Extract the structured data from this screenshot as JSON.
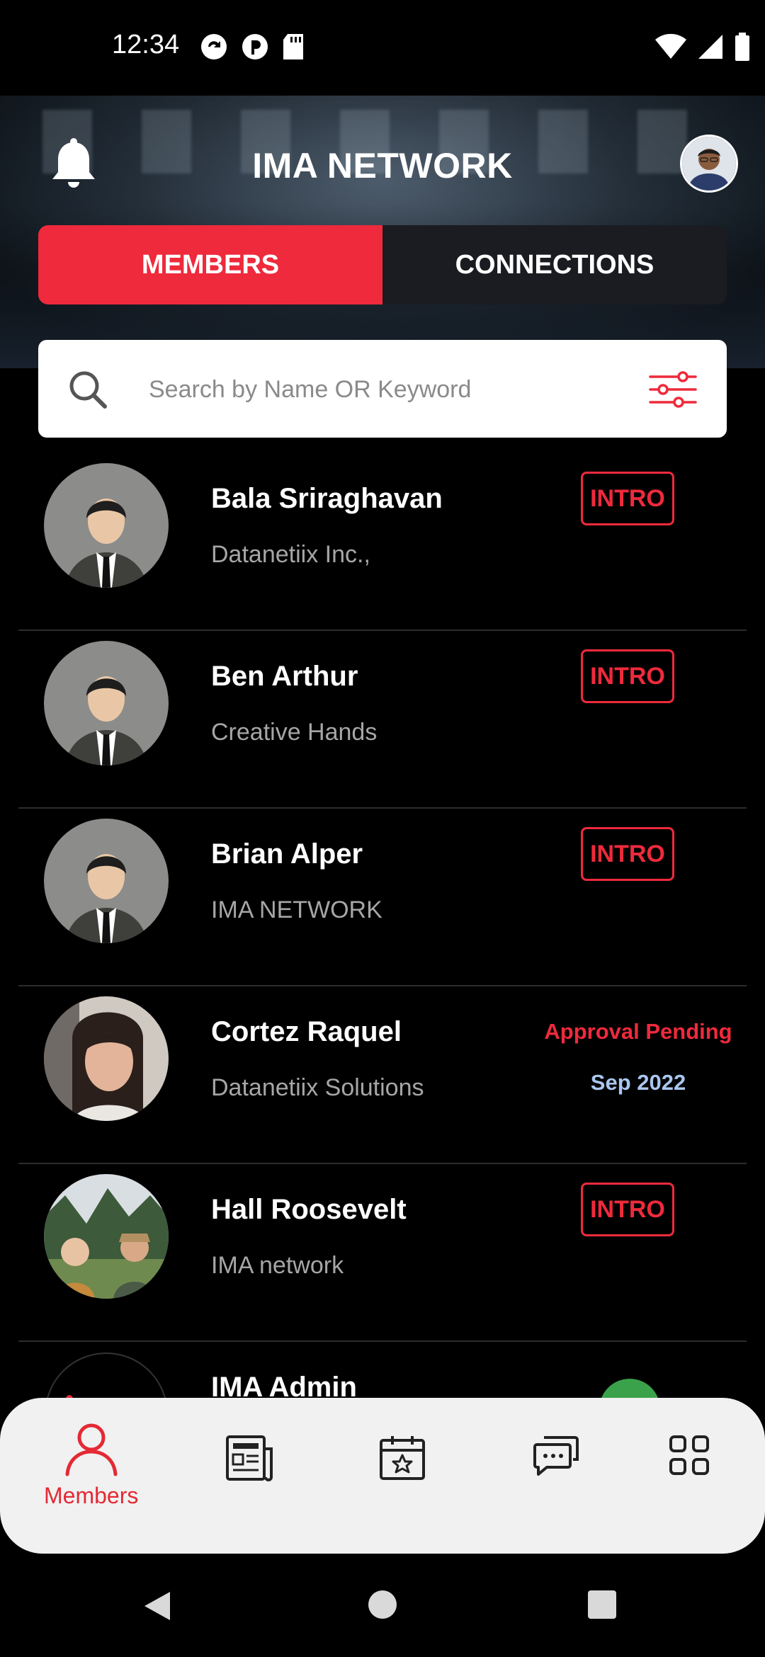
{
  "status_bar": {
    "time": "12:34",
    "left_icons": [
      "sync-icon",
      "app-icon",
      "sd-card-icon"
    ],
    "right_icons": [
      "wifi-icon",
      "signal-icon",
      "battery-icon"
    ]
  },
  "header": {
    "title": "IMA NETWORK",
    "left_icon": "bell-icon",
    "right_icon": "profile-avatar"
  },
  "tabs": [
    {
      "label": "MEMBERS",
      "active": true
    },
    {
      "label": "CONNECTIONS",
      "active": false
    }
  ],
  "search": {
    "placeholder": "Search by Name OR Keyword",
    "value": ""
  },
  "members": [
    {
      "name": "Bala Sriraghavan",
      "company": "Datanetiix Inc.,",
      "action": "INTRO",
      "avatar": "default"
    },
    {
      "name": "Ben Arthur",
      "company": "Creative Hands",
      "action": "INTRO",
      "avatar": "default"
    },
    {
      "name": "Brian Alper",
      "company": "IMA NETWORK",
      "action": "INTRO",
      "avatar": "default"
    },
    {
      "name": "Cortez Raquel",
      "company": "Datanetiix Solutions",
      "status": "Approval Pending",
      "date": "Sep 2022",
      "avatar": "photo"
    },
    {
      "name": "Hall Roosevelt",
      "company": "IMA network",
      "action": "INTRO",
      "avatar": "photo"
    },
    {
      "name": "IMA Admin",
      "company": "",
      "status_icon": "check-icon",
      "avatar": "logo"
    }
  ],
  "bottom_nav": {
    "items": [
      {
        "icon": "person-icon",
        "label": "Members",
        "active": true
      },
      {
        "icon": "news-icon",
        "label": ""
      },
      {
        "icon": "calendar-star-icon",
        "label": ""
      },
      {
        "icon": "chat-icon",
        "label": ""
      },
      {
        "icon": "grid-icon",
        "label": ""
      }
    ]
  },
  "colors": {
    "accent": "#ee2a3c",
    "pending_date": "#a9c6ee",
    "check": "#3aa24a"
  }
}
